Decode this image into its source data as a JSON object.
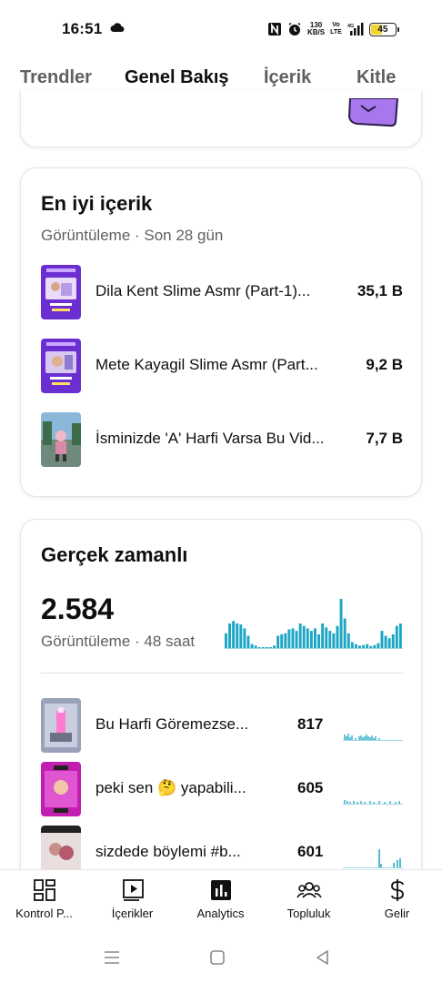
{
  "status_bar": {
    "time": "16:51",
    "net_speed_value": "130",
    "net_speed_unit": "KB/S",
    "volte_top": "Vo",
    "volte_bottom": "LTE",
    "battery": "45",
    "battery_level": 0.45
  },
  "tabs": [
    "Trendler",
    "Genel Bakış",
    "İçerik",
    "Kitle"
  ],
  "active_tab": "Genel Bakış",
  "best_content": {
    "title": "En iyi içerik",
    "subtitle": "Görüntüleme · Son 28 gün",
    "items": [
      {
        "title": "Dila Kent Slime Asmr (Part-1)...",
        "value": "35,1 B"
      },
      {
        "title": "Mete Kayagil Slime Asmr (Part...",
        "value": "9,2 B"
      },
      {
        "title": "İsminizde 'A' Harfi Varsa Bu Vid...",
        "value": "7,7 B"
      }
    ]
  },
  "realtime": {
    "title": "Gerçek zamanlı",
    "total": "2.584",
    "subtitle": "Görüntüleme · 48 saat",
    "hourly_bars": [
      0.3,
      0.5,
      0.55,
      0.5,
      0.48,
      0.4,
      0.25,
      0.08,
      0.05,
      0,
      0,
      0,
      0,
      0.05,
      0.25,
      0.28,
      0.3,
      0.38,
      0.4,
      0.35,
      0.5,
      0.45,
      0.4,
      0.35,
      0.4,
      0.28,
      0.5,
      0.42,
      0.35,
      0.3,
      0.45,
      1.0,
      0.6,
      0.3,
      0.12,
      0.08,
      0.05,
      0.06,
      0.08,
      0.04,
      0.06,
      0.1,
      0.35,
      0.25,
      0.2,
      0.28,
      0.45,
      0.5
    ],
    "items": [
      {
        "title": "Bu Harfi Göremezse...",
        "value": "817"
      },
      {
        "title": "peki sen 🤔 yapabili...",
        "value": "605"
      },
      {
        "title": "sizdede böylemi #b...",
        "value": "601"
      }
    ]
  },
  "bottom_nav": [
    {
      "label": "Kontrol P...",
      "icon": "dashboard-icon"
    },
    {
      "label": "İçerikler",
      "icon": "content-icon"
    },
    {
      "label": "Analytics",
      "icon": "analytics-icon"
    },
    {
      "label": "Topluluk",
      "icon": "community-icon"
    },
    {
      "label": "Gelir",
      "icon": "dollar-icon"
    }
  ],
  "colors": {
    "accent": "#0f0f0f",
    "secondary_text": "#606060",
    "chart_bar": "#1ca6c4",
    "battery": "#f2d533",
    "thumb_purple": "#6b2ed0"
  }
}
